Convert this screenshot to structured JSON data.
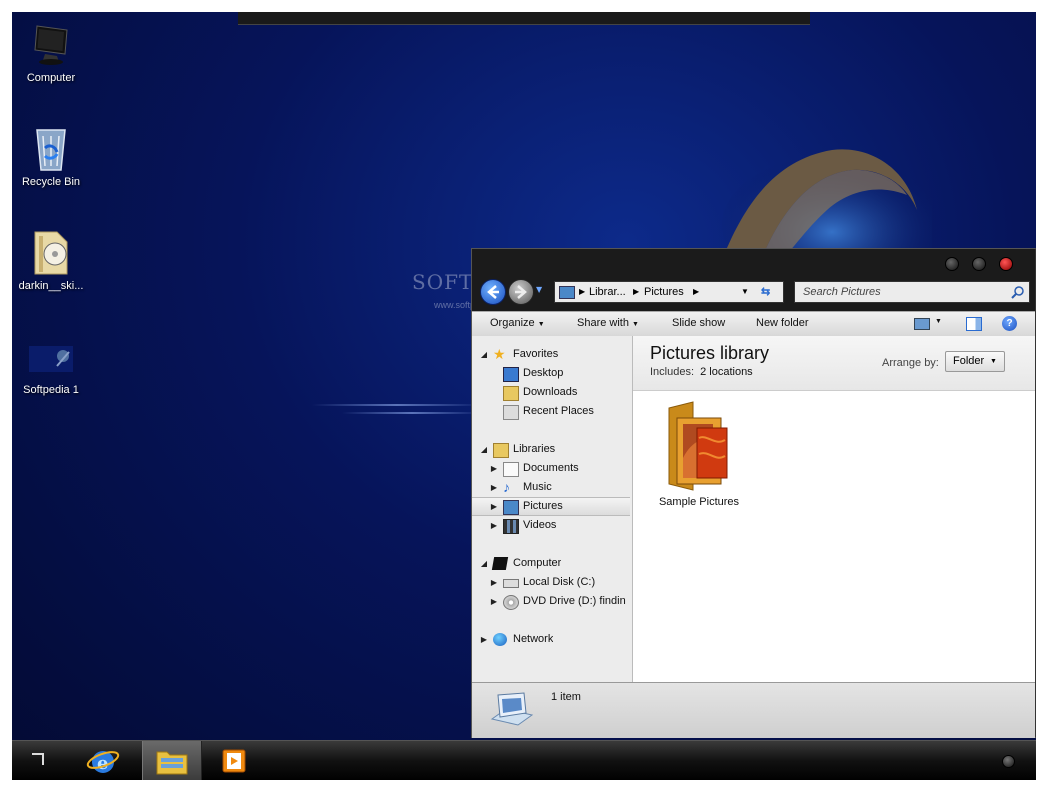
{
  "desktop": {
    "icons": [
      {
        "label": "Computer",
        "icon": "monitor-icon"
      },
      {
        "label": "Recycle Bin",
        "icon": "recycle-bin-icon"
      },
      {
        "label": "darkin__ski...",
        "icon": "zip-folder-icon"
      },
      {
        "label": "Softpedia 1",
        "icon": "image-file-icon"
      }
    ],
    "watermark": {
      "brand": "SOFTPEDIA",
      "url": "www.softpedia.com"
    }
  },
  "explorer": {
    "address": {
      "segment1": "Librar...",
      "segment2": "Pictures"
    },
    "search": {
      "placeholder": "Search Pictures"
    },
    "toolbar": {
      "organize": "Organize",
      "share_with": "Share with",
      "slide_show": "Slide show",
      "new_folder": "New folder"
    },
    "nav": {
      "favorites": "Favorites",
      "desktop": "Desktop",
      "downloads": "Downloads",
      "recent_places": "Recent Places",
      "libraries": "Libraries",
      "documents": "Documents",
      "music": "Music",
      "pictures": "Pictures",
      "videos": "Videos",
      "computer": "Computer",
      "local_disk": "Local Disk (C:)",
      "dvd_drive": "DVD Drive (D:) findin",
      "network": "Network"
    },
    "library": {
      "title": "Pictures library",
      "includes_label": "Includes:",
      "includes_link": "2 locations",
      "arrange_label": "Arrange by:",
      "arrange_value": "Folder"
    },
    "items": [
      {
        "label": "Sample Pictures",
        "icon": "picture-folder-icon"
      }
    ],
    "status": {
      "count": "1 item"
    }
  },
  "taskbar": {
    "apps": [
      "internet-explorer-icon",
      "explorer-folder-icon",
      "media-player-icon"
    ]
  },
  "colors": {
    "desktop_bg": "#06145a",
    "selection": "#dcdcdc",
    "close_button": "#cc2222"
  }
}
